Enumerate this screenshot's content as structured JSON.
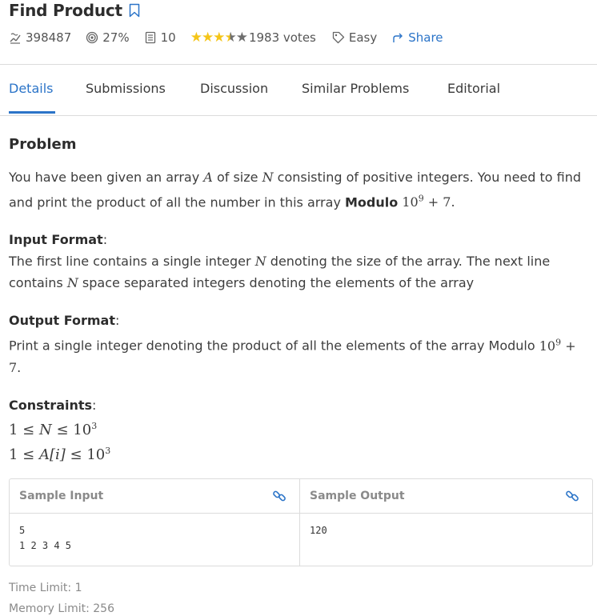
{
  "problem": {
    "title": "Find Product",
    "stats": {
      "attempts": "398487",
      "success_rate": "27%",
      "submissions": "10",
      "rating": 3.5,
      "votes": "1983 votes",
      "difficulty": "Easy",
      "share_label": "Share"
    }
  },
  "tabs": [
    {
      "label": "Details",
      "active": true
    },
    {
      "label": "Submissions",
      "active": false
    },
    {
      "label": "Discussion",
      "active": false
    },
    {
      "label": "Similar Problems",
      "active": false
    },
    {
      "label": "Editorial",
      "active": false
    }
  ],
  "content": {
    "heading": "Problem",
    "statement_part1": "You have been given an array",
    "statement_var_a": "A",
    "statement_part2": "of size",
    "statement_var_n": "N",
    "statement_part3": "consisting of positive integers. You need to find and print the product of all the number in this array",
    "statement_bold": "Modulo",
    "statement_mod": "10",
    "statement_exp": "9",
    "statement_mod_tail": "+ 7.",
    "input_label": "Input Format",
    "input_part1": "The first line contains a single integer",
    "input_var1": "N",
    "input_part2": "denoting the size of the array. The next line contains",
    "input_var2": "N",
    "input_part3": "space separated integers denoting the elements of the array",
    "output_label": "Output Format",
    "output_text": "Print a single integer denoting the product of all the elements of the array Modulo",
    "output_mod": "10",
    "output_exp": "9",
    "output_mod_tail": "+ 7.",
    "constraints_label": "Constraints",
    "constraint1": {
      "left": "1 ≤",
      "var": "N",
      "right": "≤ 10",
      "exp": "3"
    },
    "constraint2": {
      "left": "1 ≤",
      "var": "A[i]",
      "right": "≤ 10",
      "exp": "3"
    }
  },
  "samples": {
    "input_label": "Sample Input",
    "input_value": "5\n1 2 3 4 5",
    "output_label": "Sample Output",
    "output_value": "120"
  },
  "limits": {
    "time": "Time Limit: 1",
    "memory": "Memory Limit: 256"
  },
  "colors": {
    "accent": "#2b74c8",
    "star": "#f5c518",
    "border": "#dcdcdc"
  }
}
